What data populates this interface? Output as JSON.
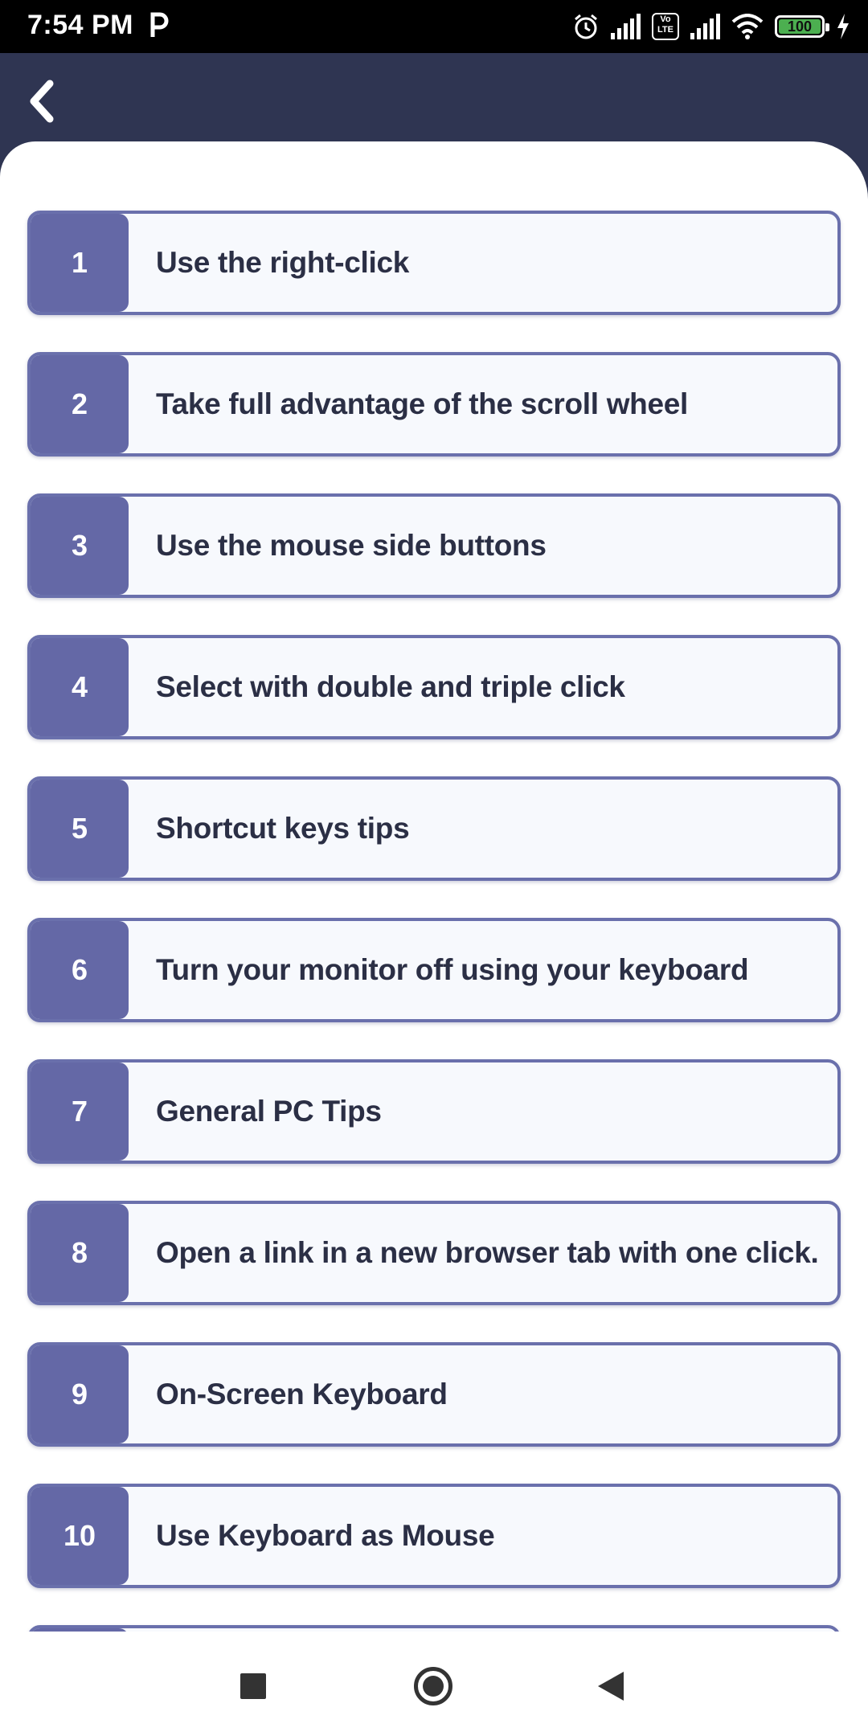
{
  "status_bar": {
    "time": "7:54 PM",
    "battery": "100",
    "volte_label": "Vo LTE"
  },
  "header": {
    "back_icon": "chevron-left-icon"
  },
  "tips": [
    {
      "number": "1",
      "label": "Use the right-click"
    },
    {
      "number": "2",
      "label": "Take full advantage of the scroll wheel"
    },
    {
      "number": "3",
      "label": "Use the mouse side buttons"
    },
    {
      "number": "4",
      "label": "Select with double and triple click"
    },
    {
      "number": "5",
      "label": "Shortcut keys tips"
    },
    {
      "number": "6",
      "label": "Turn your monitor off using your keyboard"
    },
    {
      "number": "7",
      "label": "General PC Tips"
    },
    {
      "number": "8",
      "label": "Open a link in a new browser tab with one click."
    },
    {
      "number": "9",
      "label": "On-Screen Keyboard"
    },
    {
      "number": "10",
      "label": "Use Keyboard as Mouse"
    }
  ],
  "colors": {
    "header_bg": "#2f3552",
    "number_bg": "#6468a6",
    "card_border": "#6a70ac",
    "card_bg": "#f7f9fd"
  },
  "nav": {
    "recent_icon": "square-icon",
    "home_icon": "circle-icon",
    "back_icon": "triangle-back-icon"
  }
}
